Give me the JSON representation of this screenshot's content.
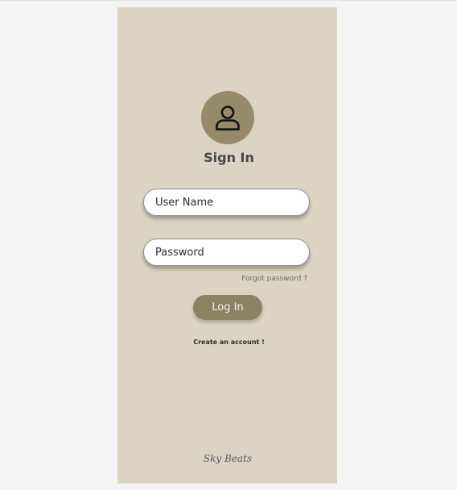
{
  "signin": {
    "title": "Sign In",
    "icon": "user-icon",
    "username_placeholder": "User Name",
    "password_placeholder": "Password",
    "forgot_password": "Forgot password ?",
    "login_label": "Log In",
    "create_account": "Create an account !"
  },
  "footer": {
    "brand": "Sky Beats"
  },
  "colors": {
    "panel_background": "#dbd4c3",
    "avatar_background": "#968a6a",
    "button_background": "#8b8163",
    "page_background": "#f4f4f4"
  }
}
